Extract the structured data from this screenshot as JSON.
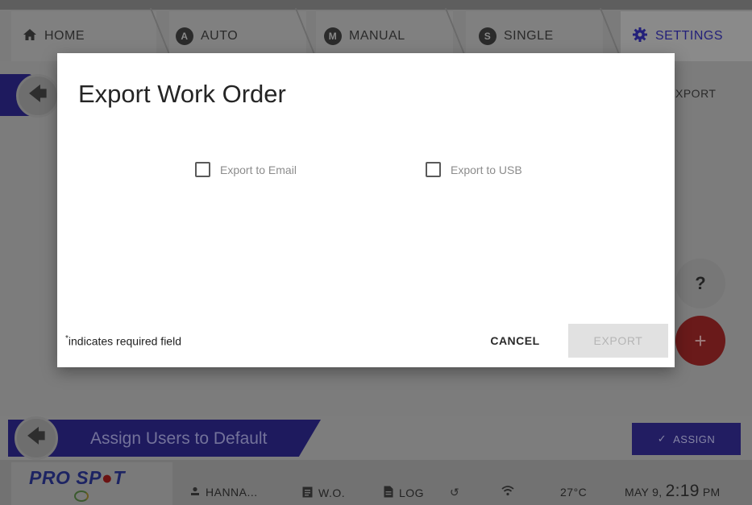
{
  "tabs": [
    {
      "label": "HOME",
      "icon": "home-icon"
    },
    {
      "label": "AUTO",
      "badge": "A",
      "icon": "auto-mode-icon"
    },
    {
      "label": "MANUAL",
      "badge": "M",
      "icon": "manual-mode-icon"
    },
    {
      "label": "SINGLE",
      "badge": "S",
      "icon": "single-mode-icon"
    },
    {
      "label": "SETTINGS",
      "icon": "gear-icon",
      "active": true
    }
  ],
  "background": {
    "export_label": "XPORT",
    "help_label": "?",
    "add_label": "+",
    "assign_title": "Assign Users to Default",
    "assign_button": "ASSIGN"
  },
  "statusbar": {
    "logo_prefix": "PRO SP",
    "logo_suffix": "T",
    "user": "HANNA...",
    "work_order": "W.O.",
    "log": "LOG",
    "temperature": "27°C",
    "date": "MAY 9,",
    "time": "2:19",
    "ampm": "PM"
  },
  "dialog": {
    "title": "Export Work Order",
    "options": [
      {
        "label": "Export to Email",
        "checked": false
      },
      {
        "label": "Export to USB",
        "checked": false
      }
    ],
    "required_marker": "*",
    "required_note": "indicates required field",
    "cancel_label": "CANCEL",
    "export_label": "EXPORT",
    "export_enabled": false
  },
  "colors": {
    "brand_navy": "#1e1a5e",
    "accent_red": "#c62828",
    "overlay_dim": "#7d7d7d"
  }
}
